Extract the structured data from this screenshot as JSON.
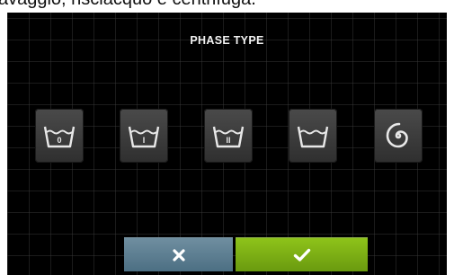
{
  "caption": "avaggio, risciacquo e centrifuga.",
  "dialog": {
    "title": "PHASE TYPE",
    "options": [
      {
        "icon": "tub-0-icon",
        "glyph": "0"
      },
      {
        "icon": "tub-1-icon",
        "glyph": "I"
      },
      {
        "icon": "tub-2-icon",
        "glyph": "II"
      },
      {
        "icon": "tub-empty-icon",
        "glyph": ""
      },
      {
        "icon": "spin-icon",
        "glyph": ""
      }
    ],
    "cancel_icon": "close-icon",
    "confirm_icon": "check-icon"
  },
  "colors": {
    "background": "#000000",
    "tile": "#3c3c3c",
    "cancel_button": "#5b7c90",
    "confirm_button": "#7db314"
  }
}
